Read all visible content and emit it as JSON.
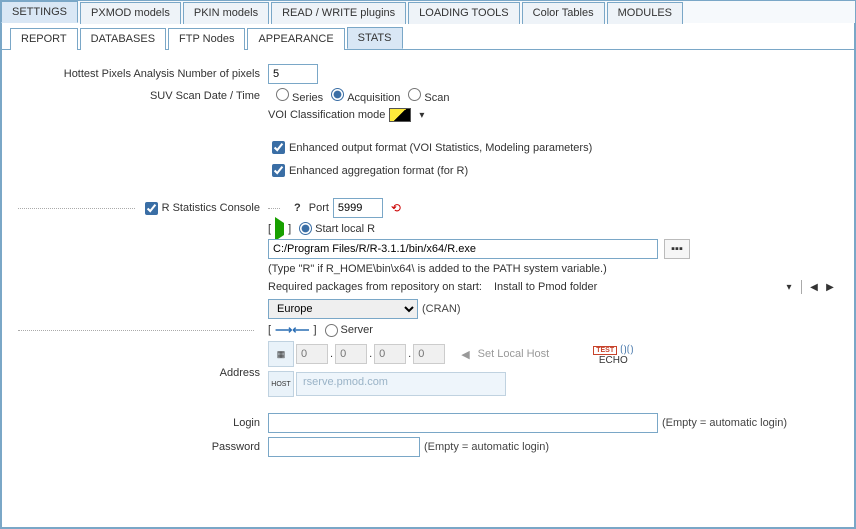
{
  "tabs_top": [
    "SETTINGS",
    "PXMOD models",
    "PKIN models",
    "READ / WRITE plugins",
    "LOADING TOOLS",
    "Color Tables",
    "MODULES"
  ],
  "tabs_sub": [
    "REPORT",
    "DATABASES",
    "FTP Nodes",
    "APPEARANCE",
    "STATS"
  ],
  "hottest_pixels": {
    "label": "Hottest Pixels Analysis Number of pixels",
    "value": "5"
  },
  "suv": {
    "label": "SUV Scan Date / Time",
    "opt_series": "Series",
    "opt_acquisition": "Acquisition",
    "opt_scan": "Scan"
  },
  "voi_label": "VOI Classification mode",
  "enhanced_output": "Enhanced output format (VOI Statistics, Modeling parameters)",
  "enhanced_aggr": "Enhanced aggregation format (for R)",
  "rconsole": {
    "label": "R Statistics Console",
    "question": "?",
    "port_label": "Port",
    "port_value": "5999",
    "start_local": "Start local R",
    "exe_path": "C:/Program Files/R/R-3.1.1/bin/x64/R.exe",
    "path_hint": "(Type \"R\" if R_HOME\\bin\\x64\\ is added to the PATH system variable.)",
    "required_pkg_label": "Required packages from repository on start:",
    "install_to": "Install to Pmod folder",
    "cran_region": "Europe",
    "cran_label": "(CRAN)",
    "server_label": "Server",
    "set_local_host": "Set Local Host",
    "address_label": "Address",
    "echo_label": "ECHO",
    "ip_placeholder": "0",
    "rserve_placeholder": "rserve.pmod.com",
    "login_label": "Login",
    "password_label": "Password",
    "empty_hint": "(Empty = automatic login)"
  }
}
